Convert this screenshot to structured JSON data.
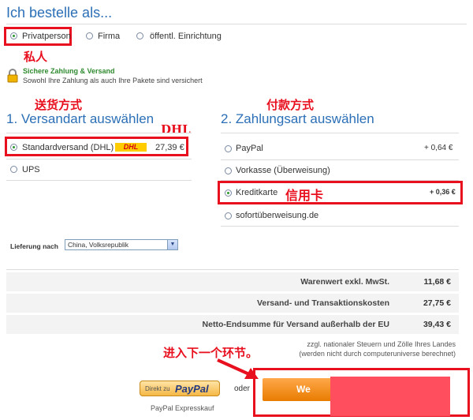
{
  "header": {
    "title": "Ich bestelle als..."
  },
  "customer_type": {
    "options": [
      "Privatperson",
      "Firma",
      "öffentl. Einrichtung"
    ],
    "selected": "Privatperson",
    "annotation": "私人"
  },
  "security": {
    "title": "Sichere Zahlung & Versand",
    "subtitle": "Sowohl Ihre Zahlung als auch Ihre Pakete sind versichert"
  },
  "shipping": {
    "annotation": "送货方式",
    "heading": "1. Versandart auswählen",
    "carrier_annotation": "DHL",
    "options": [
      {
        "label": "Standardversand (DHL)",
        "logo": "DHL",
        "price": "27,39 €",
        "selected": true
      },
      {
        "label": "UPS",
        "price": "",
        "selected": false
      }
    ]
  },
  "payment": {
    "annotation": "付款方式",
    "heading": "2. Zahlungsart auswählen",
    "options": [
      {
        "label": "PayPal",
        "fee": "+ 0,64 €",
        "selected": false
      },
      {
        "label": "Vorkasse (Überweisung)",
        "fee": "",
        "selected": false
      },
      {
        "label": "Kreditkarte",
        "fee": "+ 0,36 €",
        "selected": true,
        "annotation": "信用卡"
      },
      {
        "label": "sofortüberweisung.de",
        "fee": "",
        "selected": false
      }
    ]
  },
  "delivery": {
    "label": "Lieferung nach",
    "selected_country": "China, Volksrepublik"
  },
  "summary": {
    "rows": [
      {
        "label": "Warenwert exkl. MwSt.",
        "value": "11,68 €"
      },
      {
        "label": "Versand- und Transaktionskosten",
        "value": "27,75 €"
      },
      {
        "label": "Netto-Endsumme für Versand außerhalb der EU",
        "value": "39,43 €"
      }
    ],
    "note_line1": "zzgl. nationaler Steuern und Zölle Ihres Landes",
    "note_line2": "(werden nicht durch computeruniverse berechnet)"
  },
  "actions": {
    "next_annotation": "进入下一个环节。",
    "paypal_direct": "Direkt zu",
    "paypal_logo": "PayPal",
    "paypal_caption": "PayPal Expresskauf",
    "or_label": "oder",
    "continue_label": "We"
  },
  "colors": {
    "accent_blue": "#2b6fb6",
    "annotation_red": "#e8101e",
    "continue_orange": "#f28a00",
    "redaction_pink": "#ff4f5e"
  }
}
